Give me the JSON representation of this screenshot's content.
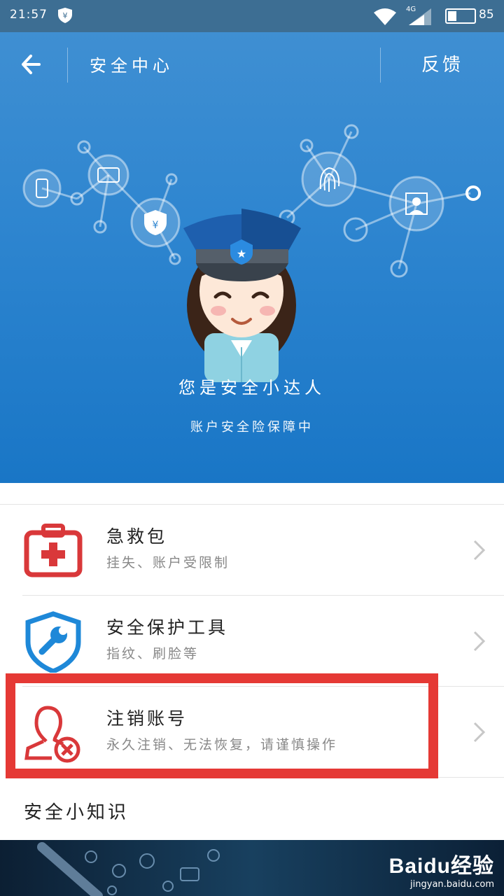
{
  "status_bar": {
    "time": "21:57",
    "network": "4G",
    "battery": "85",
    "battery_level_pct": 30
  },
  "header": {
    "title": "安全中心",
    "feedback_label": "反馈"
  },
  "hero": {
    "title": "您是安全小达人",
    "subtitle": "账户安全险保障中"
  },
  "list_items": [
    {
      "title": "急救包",
      "subtitle": "挂失、账户受限制",
      "icon": "first-aid-kit-icon",
      "color": "#d9383a"
    },
    {
      "title": "安全保护工具",
      "subtitle": "指纹、刷脸等",
      "icon": "shield-wrench-icon",
      "color": "#1e88d8"
    },
    {
      "title": "注销账号",
      "subtitle": "永久注销、无法恢复，请谨慎操作",
      "icon": "user-remove-icon",
      "color": "#d9383a"
    }
  ],
  "knowledge": {
    "title": "安全小知识"
  },
  "watermark": {
    "logo": "Baidu经验",
    "url": "jingyan.baidu.com"
  },
  "colors": {
    "hero_blue": "#2f86d0",
    "highlight_red": "#e53935",
    "status_bar": "#3d6e93"
  }
}
